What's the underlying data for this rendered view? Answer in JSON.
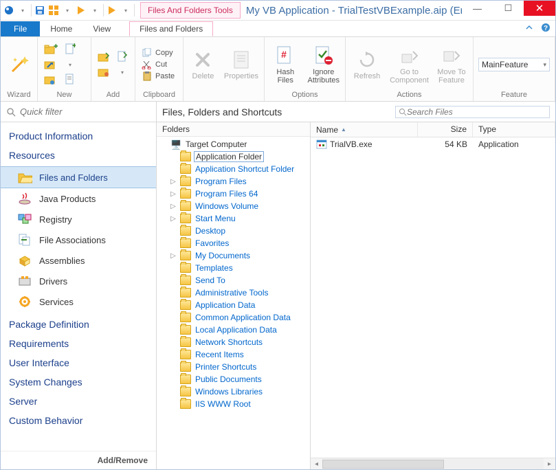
{
  "window": {
    "contextual_group": "Files And Folders Tools",
    "title": "My VB Application - TrialTestVBExample.aip (English ..."
  },
  "ribbon_tabs": {
    "file": "File",
    "home": "Home",
    "view": "View",
    "files_and_folders": "Files and Folders"
  },
  "ribbon": {
    "wizard": {
      "label": "Wizard"
    },
    "new": {
      "label": "New"
    },
    "add": {
      "label": "Add"
    },
    "clipboard": {
      "label": "Clipboard",
      "copy": "Copy",
      "cut": "Cut",
      "paste": "Paste"
    },
    "edit_group": {
      "delete": "Delete",
      "properties": "Properties"
    },
    "options": {
      "label": "Options",
      "hash": "Hash\nFiles",
      "ignore": "Ignore\nAttributes"
    },
    "actions": {
      "label": "Actions",
      "refresh": "Refresh",
      "goto": "Go to\nComponent",
      "move": "Move To\nFeature"
    },
    "feature": {
      "label": "Feature",
      "value": "MainFeature"
    }
  },
  "quick_filter_placeholder": "Quick filter",
  "nav": {
    "sections": {
      "product_info": "Product Information",
      "resources": "Resources",
      "package_def": "Package Definition",
      "requirements": "Requirements",
      "ui": "User Interface",
      "sys_changes": "System Changes",
      "server": "Server",
      "custom": "Custom Behavior"
    },
    "resource_items": {
      "files": "Files and Folders",
      "java": "Java Products",
      "registry": "Registry",
      "file_assoc": "File Associations",
      "assemblies": "Assemblies",
      "drivers": "Drivers",
      "services": "Services"
    },
    "footer": "Add/Remove"
  },
  "content": {
    "title": "Files, Folders and Shortcuts",
    "search_placeholder": "Search Files",
    "folders_pane_title": "Folders",
    "tree": {
      "root": "Target Computer",
      "app_folder": "Application Folder",
      "items": [
        "Application Shortcut Folder",
        "Program Files",
        "Program Files 64",
        "Windows Volume",
        "Start Menu",
        "Desktop",
        "Favorites",
        "My Documents",
        "Templates",
        "Send To",
        "Administrative Tools",
        "Application Data",
        "Common Application Data",
        "Local Application Data",
        "Network Shortcuts",
        "Recent Items",
        "Printer Shortcuts",
        "Public Documents",
        "Windows Libraries",
        "IIS WWW Root"
      ],
      "expandable_indices": [
        1,
        2,
        3,
        4,
        7
      ]
    },
    "columns": {
      "name": "Name",
      "size": "Size",
      "type": "Type"
    },
    "files": [
      {
        "name": "TrialVB.exe",
        "size": "54 KB",
        "type": "Application"
      }
    ]
  }
}
